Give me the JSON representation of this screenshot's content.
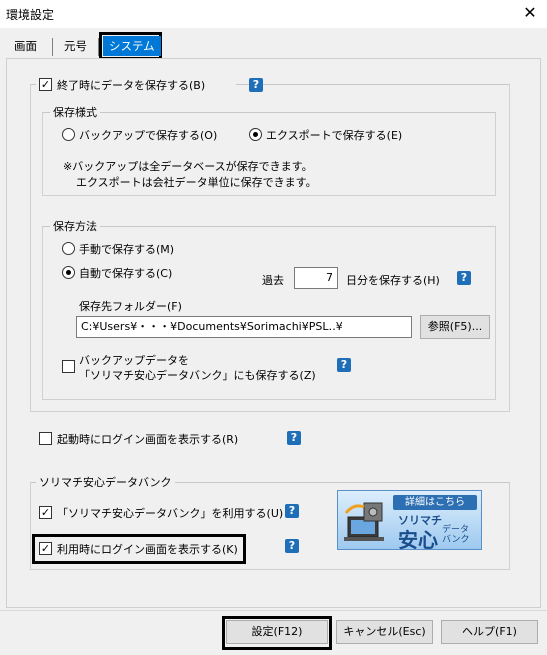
{
  "window": {
    "title": "環境設定",
    "close": "✕"
  },
  "tabs": [
    {
      "label": "画面"
    },
    {
      "label": "元号"
    },
    {
      "label": "システム"
    }
  ],
  "save_on_exit": {
    "label": "終了時にデータを保存する(B)",
    "checked": true,
    "help": "?"
  },
  "save_style": {
    "label": "保存様式",
    "opt_backup": "バックアップで保存する(O)",
    "opt_export": "エクスポートで保存する(E)",
    "note_line1": "※バックアップは全データベースが保存できます。",
    "note_line2": "エクスポートは会社データ単位に保存できます。"
  },
  "save_method": {
    "label": "保存方法",
    "opt_manual": "手動で保存する(M)",
    "opt_auto": "自動で保存する(C)",
    "past_label": "過去",
    "days_value": "7",
    "days_suffix": "日分を保存する(H)",
    "folder_label": "保存先フォルダー(F)",
    "folder_value": "C:¥Users¥・・・¥Documents¥Sorimachi¥PSL‥¥",
    "browse": "参照(F5)...",
    "also_bank_line1": "バックアップデータを",
    "also_bank_line2": "「ソリマチ安心データバンク」にも保存する(Z)"
  },
  "login_on_start": {
    "label": "起動時にログイン画面を表示する(R)",
    "checked": false
  },
  "bank": {
    "label": "ソリマチ安心データバンク",
    "use": "「ソリマチ安心データバンク」を利用する(U)",
    "use_checked": true,
    "login": "利用時にログイン画面を表示する(K)",
    "login_checked": true,
    "banner_top": "詳細はこちら",
    "banner_a": "ソリマチ",
    "banner_b": "安心",
    "banner_c1": "データ",
    "banner_c2": "バンク"
  },
  "buttons": {
    "ok": "設定(F12)",
    "cancel": "キャンセル(Esc)",
    "help": "ヘルプ(F1)"
  },
  "colors": {
    "accent": "#0078d7",
    "help_icon": "#1e6fb8"
  }
}
